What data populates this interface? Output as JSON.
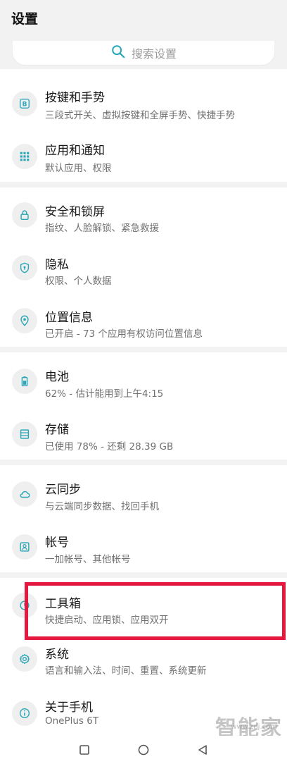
{
  "header": {
    "title": "设置"
  },
  "search": {
    "placeholder": "搜索设置"
  },
  "sections": [
    {
      "items": [
        {
          "title": "按键和手势",
          "subtitle": "三段式开关、虚拟按键和全屏手势、快捷手势",
          "icon": "b-key-icon"
        },
        {
          "title": "应用和通知",
          "subtitle": "默认应用、权限",
          "icon": "grid-apps-icon"
        }
      ]
    },
    {
      "items": [
        {
          "title": "安全和锁屏",
          "subtitle": "指纹、人脸解锁、紧急救援",
          "icon": "lock-icon"
        },
        {
          "title": "隐私",
          "subtitle": "权限、个人数据",
          "icon": "privacy-shield-icon"
        },
        {
          "title": "位置信息",
          "subtitle": "已开启 - 73 个应用有权访问位置信息",
          "icon": "location-pin-icon"
        }
      ]
    },
    {
      "items": [
        {
          "title": "电池",
          "subtitle": "62% - 估计能用到上午4:15",
          "icon": "battery-icon"
        },
        {
          "title": "存储",
          "subtitle": "已使用 78% - 还剩 28.39 GB",
          "icon": "storage-icon"
        }
      ]
    },
    {
      "items": [
        {
          "title": "云同步",
          "subtitle": "与云端同步数据、找回手机",
          "icon": "cloud-icon"
        },
        {
          "title": "帐号",
          "subtitle": "一加帐号、其他帐号",
          "icon": "account-icon"
        }
      ]
    },
    {
      "items": [
        {
          "title": "工具箱",
          "subtitle": "快捷启动、应用锁、应用双开",
          "icon": "toolbox-icon"
        },
        {
          "title": "系统",
          "subtitle": "语言和输入法、时间、重置、系统更新",
          "icon": "gear-icon"
        },
        {
          "title": "关于手机",
          "subtitle": "OnePlus 6T",
          "icon": "info-icon"
        }
      ]
    }
  ],
  "watermark": {
    "text": "智能家",
    "url": "www.znj.com"
  },
  "colors": {
    "accent": "#2aa7b8",
    "highlight": "#e5183f",
    "background": "#f2f2f2"
  }
}
